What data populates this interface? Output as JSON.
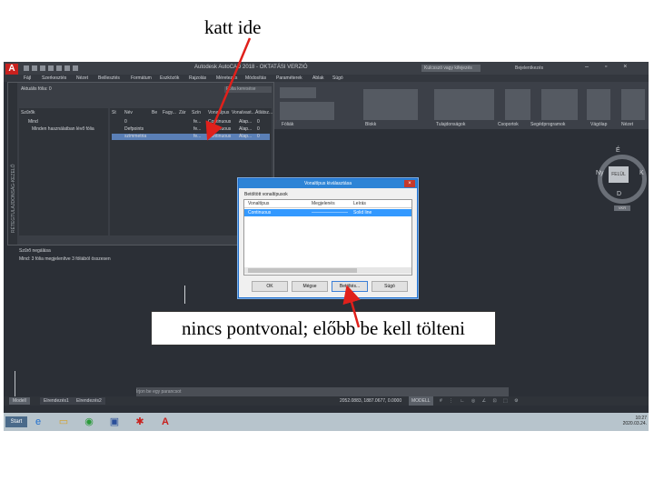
{
  "annotation_top": "katt ide",
  "annotation_bottom": "nincs pontvonal; előbb be kell tölteni",
  "app": {
    "title": "Autodesk AutoCAD 2018 - OKTATÁSI VERZIÓ",
    "logo": "A",
    "search_placeholder": "Kulcsszó vagy kifejezés",
    "user": "Bejelentkezés",
    "window_controls": "– ▫ ×"
  },
  "menu": [
    "Fájl",
    "Szerkesztés",
    "Nézet",
    "Beillesztés",
    "Formátum",
    "Eszközök",
    "Rajzolás",
    "Méretezés",
    "Módosítás",
    "Paraméterek",
    "Ablak",
    "Súgó"
  ],
  "layer_palette": {
    "side_title": "RÉTEGTULAJDONSÁG-KEZELŐ",
    "current": "Aktuális fólia: 0",
    "search_placeholder": "Fólia keresése",
    "tree_header": "Szűrők",
    "tree_all": "Mind",
    "tree_used": "Minden használatban lévő fólia",
    "columns": [
      "St",
      "Név",
      "Be",
      "Fagy...",
      "Zár",
      "Szín",
      "Vonaltípus",
      "Vonalvast...",
      "Átlátsz..."
    ],
    "rows": [
      {
        "name": "0",
        "color": "fe...",
        "linetype": "Continuous",
        "lineweight": "Alap...",
        "transp": "0"
      },
      {
        "name": "Defpoints",
        "color": "fe...",
        "linetype": "Continuous",
        "lineweight": "Alap...",
        "transp": "0"
      },
      {
        "name": "szimmetria",
        "color": "fe...",
        "linetype": "Continuous",
        "lineweight": "Alap...",
        "transp": "0"
      }
    ],
    "invert_filter": "Szűrő negálása",
    "summary": "Mind: 3 fólia megjelenítve 3 fóliából összesen"
  },
  "ribbon": {
    "panels": [
      "Fóliák",
      "Blokk",
      "Tulajdonságok",
      "Csoportok",
      "Segédprogramok",
      "Vágólap",
      "Nézet"
    ]
  },
  "viewcube": {
    "face": "FELÜL",
    "north": "É",
    "south": "D",
    "west": "Ny",
    "east": "K",
    "wcs": "VKR"
  },
  "dialog": {
    "title": "Vonaltípus kiválasztása",
    "label": "Betöltött vonaltípusok",
    "columns": [
      "Vonaltípus",
      "Megjelenés",
      "Leírás"
    ],
    "rows": [
      {
        "linetype": "Continuous",
        "appearance": "————————",
        "description": "Solid line"
      }
    ],
    "buttons": {
      "ok": "OK",
      "cancel": "Mégse",
      "load": "Betöltés...",
      "help": "Súgó"
    }
  },
  "command_placeholder": "Írjon be egy parancsot",
  "layout_tabs": [
    "Modell",
    "Elrendezés1",
    "Elrendezés2"
  ],
  "status": {
    "coords": "2052.0883, 1887.0677, 0.0000",
    "model": "MODELL",
    "icons": "# ⋮ ∟ ◎ ∠ ⊡ ⬚ ⚙"
  },
  "taskbar": {
    "start": "Start",
    "clock_time": "10:27",
    "clock_date": "2020.03.24."
  }
}
